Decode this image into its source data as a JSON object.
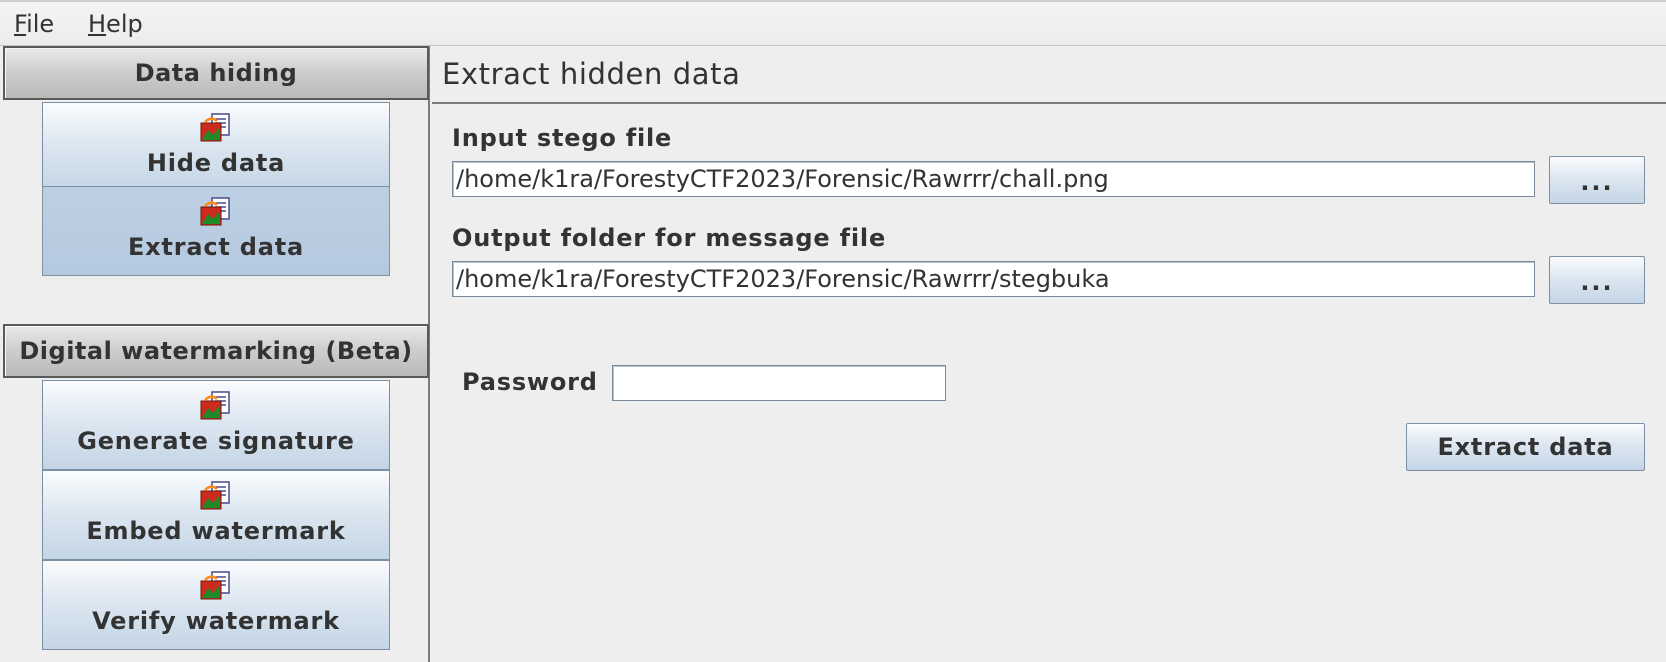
{
  "menu": {
    "file": {
      "mnemonic": "F",
      "rest": "ile"
    },
    "help": {
      "mnemonic": "H",
      "rest": "elp"
    }
  },
  "sidebar": {
    "sections": [
      {
        "header": "Data hiding",
        "items": [
          {
            "label": "Hide data",
            "icon": "stego-file-icon",
            "selected": false
          },
          {
            "label": "Extract data",
            "icon": "stego-file-icon",
            "selected": true
          }
        ]
      },
      {
        "header": "Digital watermarking (Beta)",
        "items": [
          {
            "label": "Generate signature",
            "icon": "stego-file-icon",
            "selected": false
          },
          {
            "label": "Embed watermark",
            "icon": "stego-file-icon",
            "selected": false
          },
          {
            "label": "Verify watermark",
            "icon": "stego-file-icon",
            "selected": false
          }
        ]
      }
    ]
  },
  "main": {
    "title": "Extract hidden data",
    "input_stego": {
      "label": "Input stego file",
      "value": "/home/k1ra/ForestyCTF2023/Forensic/Rawrrr/chall.png",
      "browse_label": "..."
    },
    "output_folder": {
      "label": "Output folder for message file",
      "value": "/home/k1ra/ForestyCTF2023/Forensic/Rawrrr/stegbuka",
      "browse_label": "..."
    },
    "password": {
      "label": "Password",
      "value": ""
    },
    "action_button": "Extract data"
  },
  "colors": {
    "background": "#eeeeee",
    "button_top": "#fbfcfe",
    "button_bottom": "#c4d5e6",
    "selected_item": "#b5c9df",
    "text": "#333333"
  }
}
